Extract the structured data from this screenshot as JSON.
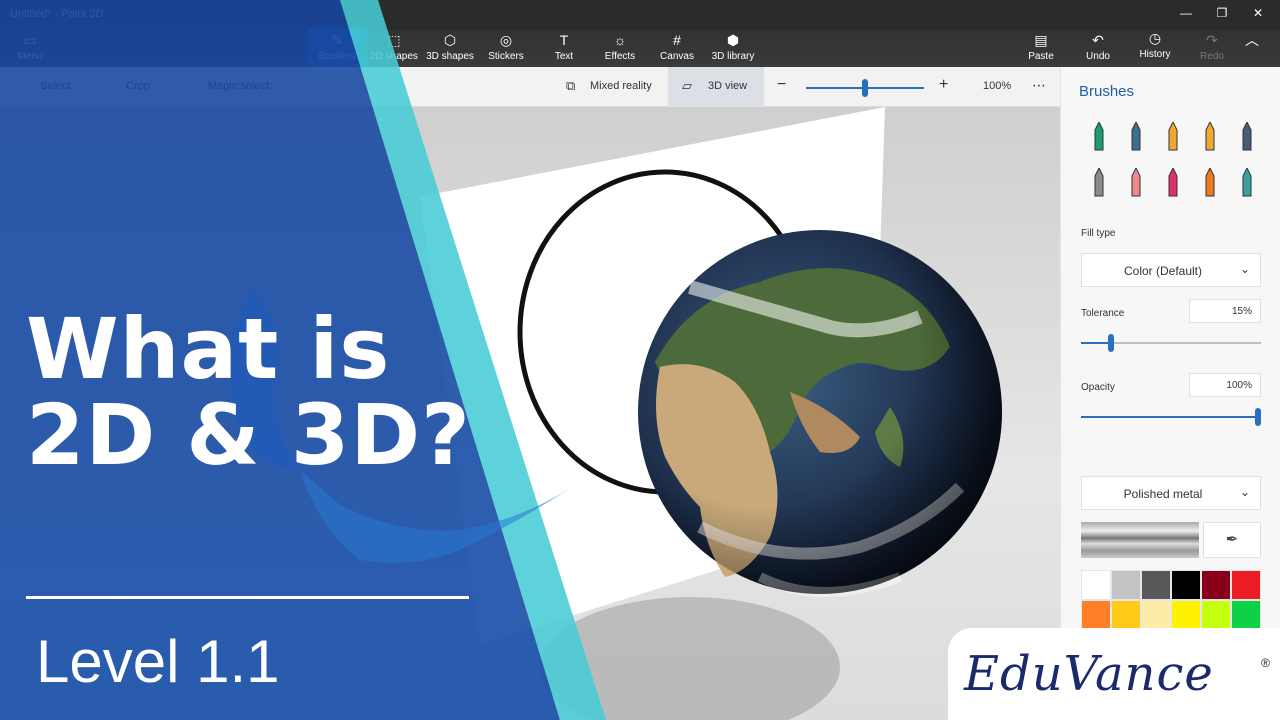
{
  "window": {
    "title": "Untitled* - Paint 3D"
  },
  "ribbon": {
    "menu": {
      "label": "Menu"
    },
    "tools": [
      {
        "label": "Brushes",
        "icon": "brush-icon"
      },
      {
        "label": "2D shapes",
        "icon": "2d-shapes-icon"
      },
      {
        "label": "3D shapes",
        "icon": "3d-shapes-icon"
      },
      {
        "label": "Stickers",
        "icon": "stickers-icon"
      },
      {
        "label": "Text",
        "icon": "text-icon"
      },
      {
        "label": "Effects",
        "icon": "effects-icon"
      },
      {
        "label": "Canvas",
        "icon": "canvas-icon"
      },
      {
        "label": "3D library",
        "icon": "3d-library-icon"
      }
    ],
    "right": [
      {
        "label": "Paste",
        "icon": "paste-icon"
      },
      {
        "label": "Undo",
        "icon": "undo-icon"
      },
      {
        "label": "History",
        "icon": "history-icon"
      },
      {
        "label": "Redo",
        "icon": "redo-icon"
      }
    ]
  },
  "subbar": {
    "select": "Select",
    "crop": "Crop",
    "magic_select": "Magic select",
    "mixed_reality": "Mixed reality",
    "view3d": "3D view",
    "zoom": "100%"
  },
  "panel": {
    "heading": "Brushes",
    "fill_type_label": "Fill type",
    "fill_type_value": "Color (Default)",
    "tolerance_label": "Tolerance",
    "tolerance_value": "15%",
    "tolerance_level": 0.15,
    "opacity_label": "Opacity",
    "opacity_value": "100%",
    "opacity_level": 1.0,
    "material_value": "Polished metal",
    "brushes": [
      {
        "name": "marker",
        "color": "#1a9e6e"
      },
      {
        "name": "calligraphy-pen",
        "color": "#3a6f8f"
      },
      {
        "name": "oil-brush",
        "color": "#f0a830"
      },
      {
        "name": "watercolor",
        "color": "#f0a830"
      },
      {
        "name": "pixel-pen",
        "color": "#4a5a7a"
      },
      {
        "name": "pencil",
        "color": "#8a8a8a"
      },
      {
        "name": "eraser",
        "color": "#f08a8a"
      },
      {
        "name": "crayon",
        "color": "#e0306a"
      },
      {
        "name": "spray-can",
        "color": "#f07a20"
      },
      {
        "name": "fill",
        "color": "#3aa0a0"
      }
    ],
    "palette": [
      "#ffffff",
      "#c3c3c3",
      "#585858",
      "#000000",
      "#88001b",
      "#ec1c24",
      "#ff7f27",
      "#ffca18",
      "#fdeca6",
      "#fff200",
      "#c4ff0e",
      "#0ed145"
    ]
  },
  "overlay": {
    "headline_line1": "What is",
    "headline_line2": "2D & 3D?",
    "level": "Level 1.1",
    "logo": "EduVance",
    "logo_mark": "®"
  }
}
